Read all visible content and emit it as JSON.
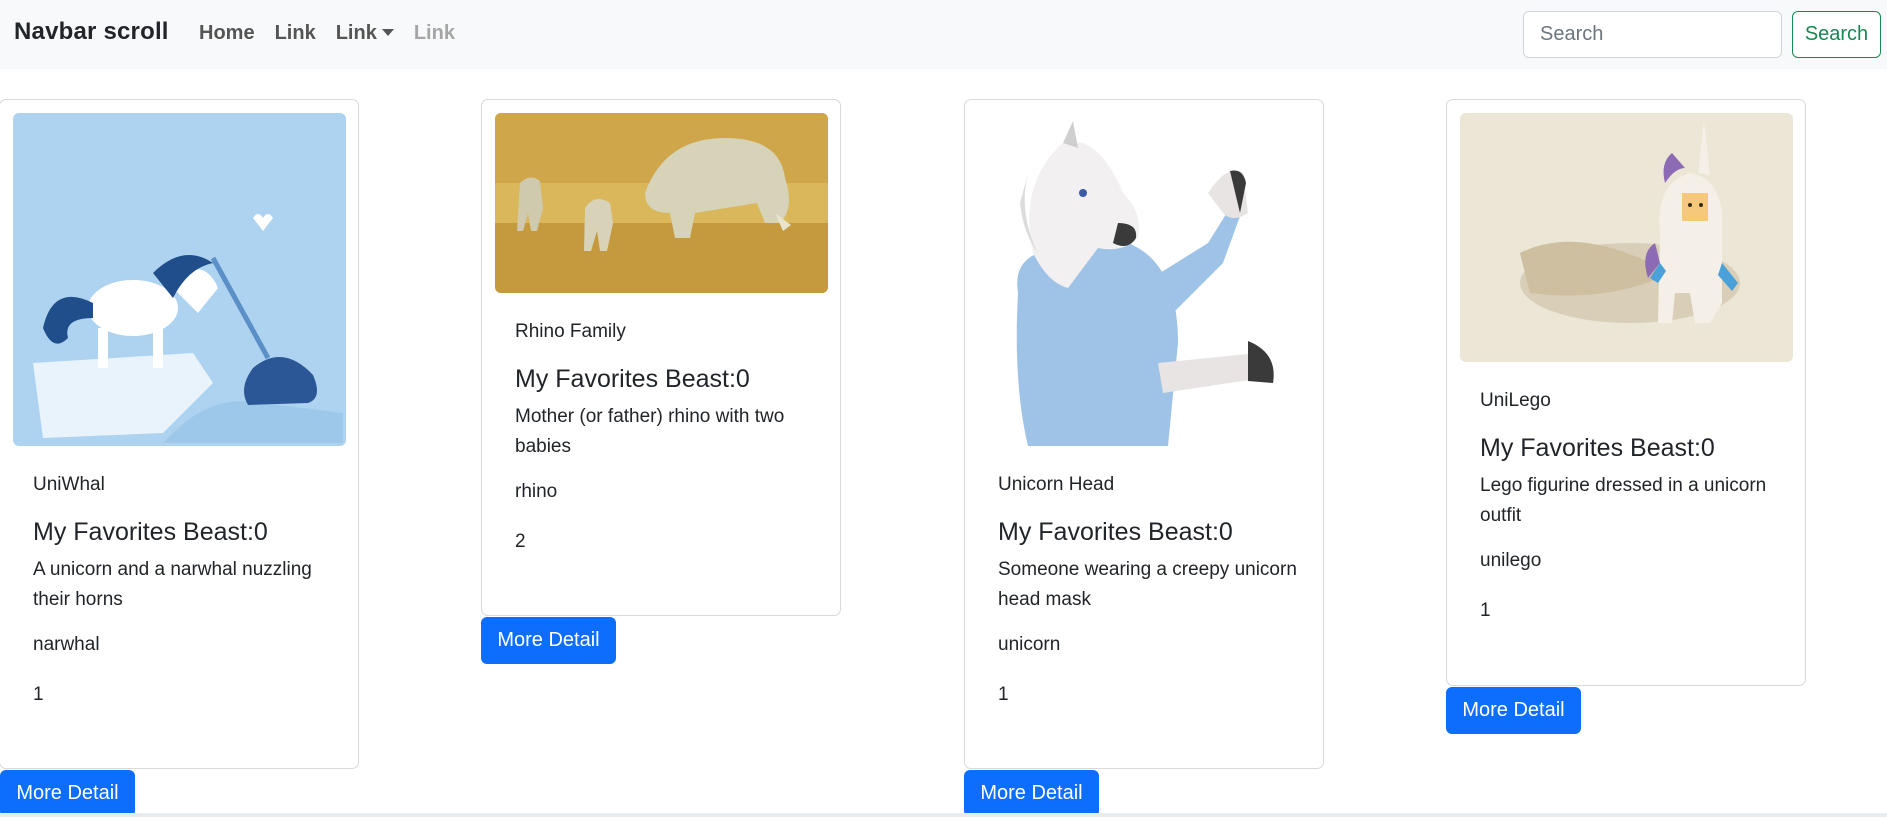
{
  "navbar": {
    "brand": "Navbar scroll",
    "links": [
      "Home",
      "Link",
      "Link",
      "Link"
    ],
    "search_placeholder": "Search",
    "search_button": "Search"
  },
  "cards": [
    {
      "title": "UniWhal",
      "heading": "My Favorites Beast:0",
      "description": "A unicorn and a narwhal nuzzling their horns",
      "keyword": "narwhal",
      "horns": "1",
      "button": "More Detail",
      "image_icon": "unicorn-narwhal-illustration"
    },
    {
      "title": "Rhino Family",
      "heading": "My Favorites Beast:0",
      "description": "Mother (or father) rhino with two babies",
      "keyword": "rhino",
      "horns": "2",
      "button": "More Detail",
      "image_icon": "rhino-family-photo"
    },
    {
      "title": "Unicorn Head",
      "heading": "My Favorites Beast:0",
      "description": "Someone wearing a creepy unicorn head mask",
      "keyword": "unicorn",
      "horns": "1",
      "button": "More Detail",
      "image_icon": "unicorn-mask-photo"
    },
    {
      "title": "UniLego",
      "heading": "My Favorites Beast:0",
      "description": "Lego figurine dressed in a unicorn outfit",
      "keyword": "unilego",
      "horns": "1",
      "button": "More Detail",
      "image_icon": "lego-unicorn-photo"
    }
  ],
  "colors": {
    "primary": "#0d6efd",
    "success": "#198754",
    "navbar_bg": "#f8f9fa"
  }
}
